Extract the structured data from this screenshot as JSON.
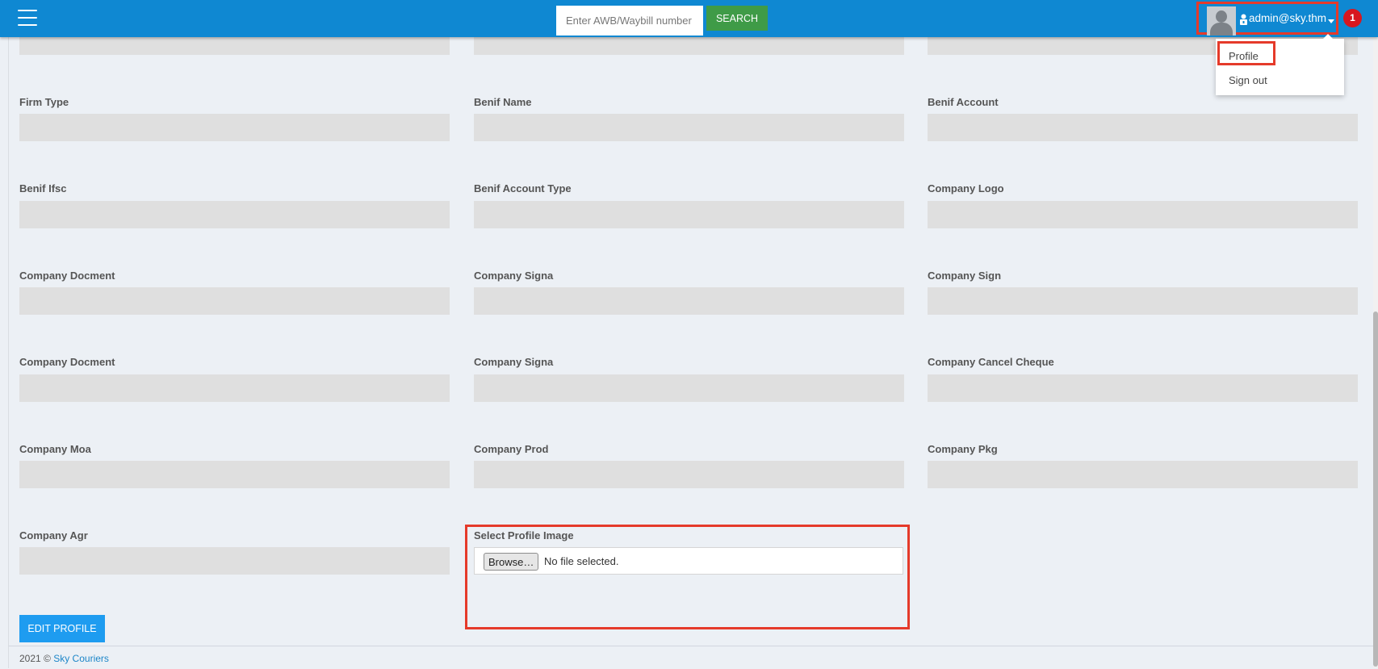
{
  "header": {
    "search_placeholder": "Enter AWB/Waybill number",
    "search_button": "SEARCH",
    "user_email": "admin@sky.thm",
    "notification_count": "1"
  },
  "user_menu": {
    "profile": "Profile",
    "sign_out": "Sign out"
  },
  "form": {
    "fields": [
      "Firm Type",
      "Benif Name",
      "Benif Account",
      "Benif Ifsc",
      "Benif Account Type",
      "Company Logo",
      "Company Docment",
      "Company Signa",
      "Company Sign",
      "Company Docment",
      "Company Signa",
      "Company Cancel Cheque",
      "Company Moa",
      "Company Prod",
      "Company Pkg",
      "Company Agr"
    ],
    "profile_image_label": "Select Profile Image",
    "browse_button": "Browse…",
    "no_file_text": "No file selected.",
    "edit_button": "EDIT PROFILE"
  },
  "footer": {
    "copyright": "2021 © ",
    "company_link": "Sky Couriers"
  },
  "colors": {
    "navbar": "#0f88d2",
    "search_button": "#3f9b47",
    "edit_button": "#1e9cf0",
    "highlight": "#e53a2a",
    "badge": "#d7171f"
  }
}
